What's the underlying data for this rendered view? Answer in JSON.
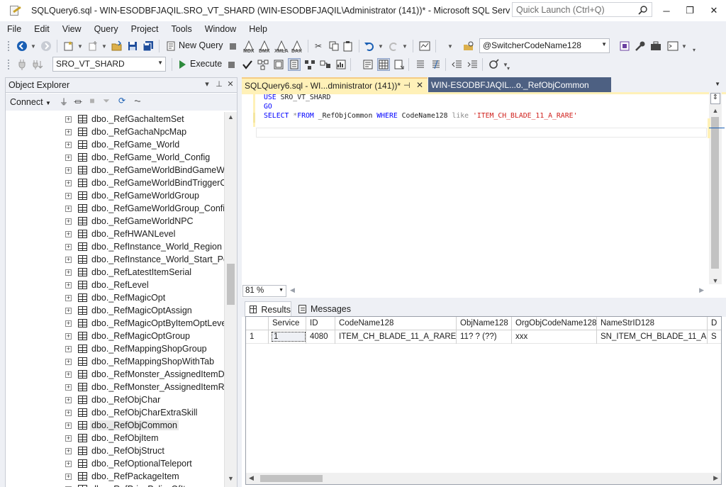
{
  "window": {
    "title": "SQLQuery6.sql - WIN-ESODBFJAQIL.SRO_VT_SHARD (WIN-ESODBFJAQIL\\Administrator (141))* - Microsoft SQL Server Manage...",
    "quick_launch_placeholder": "Quick Launch (Ctrl+Q)",
    "minimize": "─",
    "restore": "❐",
    "close": "✕"
  },
  "menu": [
    "File",
    "Edit",
    "View",
    "Query",
    "Project",
    "Tools",
    "Window",
    "Help"
  ],
  "toolbar1": {
    "new_query": "New Query",
    "mdx": "MDX",
    "dmx": "DMX",
    "xmla": "XMLA",
    "dax": "DAX",
    "search_combo": "@SwitcherCodeName128"
  },
  "toolbar2": {
    "database": "SRO_VT_SHARD",
    "execute": "Execute"
  },
  "object_explorer": {
    "title": "Object Explorer",
    "connect": "Connect",
    "items": [
      "dbo._RefGachaItemSet",
      "dbo._RefGachaNpcMap",
      "dbo._RefGame_World",
      "dbo._RefGame_World_Config",
      "dbo._RefGameWorldBindGameWorl",
      "dbo._RefGameWorldBindTriggerCat",
      "dbo._RefGameWorldGroup",
      "dbo._RefGameWorldGroup_Config",
      "dbo._RefGameWorldNPC",
      "dbo._RefHWANLevel",
      "dbo._RefInstance_World_Region",
      "dbo._RefInstance_World_Start_Pos",
      "dbo._RefLatestItemSerial",
      "dbo._RefLevel",
      "dbo._RefMagicOpt",
      "dbo._RefMagicOptAssign",
      "dbo._RefMagicOptByItemOptLevel",
      "dbo._RefMagicOptGroup",
      "dbo._RefMappingShopGroup",
      "dbo._RefMappingShopWithTab",
      "dbo._RefMonster_AssignedItemDrop",
      "dbo._RefMonster_AssignedItemRnd",
      "dbo._RefObjChar",
      "dbo._RefObjCharExtraSkill",
      "dbo._RefObjCommon",
      "dbo._RefObjItem",
      "dbo._RefObjStruct",
      "dbo._RefOptionalTeleport",
      "dbo._RefPackageItem",
      "dbo._RefPricePolicyOfItem"
    ],
    "selected_index": 24
  },
  "tabs": {
    "active": "SQLQuery6.sql - WI...dministrator (141))*",
    "inactive": "WIN-ESODBFJAQIL...o._RefObjCommon"
  },
  "editor": {
    "line1_kw": "USE",
    "line1_rest": " SRO_VT_SHARD",
    "line2_kw": "GO",
    "line3_kw1": "SELECT",
    "line3_op": " *",
    "line3_kw2": "FROM",
    "line3_table": " _RefObjCommon ",
    "line3_kw3": "WHERE",
    "line3_col": " CodeName128 ",
    "line3_op2": "like",
    "line3_str": " 'ITEM_CH_BLADE_11_A_RARE'",
    "zoom": "81 %"
  },
  "results": {
    "tab_results": "Results",
    "tab_messages": "Messages",
    "columns": [
      "",
      "Service",
      "ID",
      "CodeName128",
      "ObjName128",
      "OrgObjCodeName128",
      "NameStrID128",
      "D"
    ],
    "rows": [
      [
        "1",
        "1",
        "4080",
        "ITEM_CH_BLADE_11_A_RARE",
        "11? ? (??)",
        "xxx",
        "SN_ITEM_CH_BLADE_11_A",
        "S"
      ]
    ]
  }
}
